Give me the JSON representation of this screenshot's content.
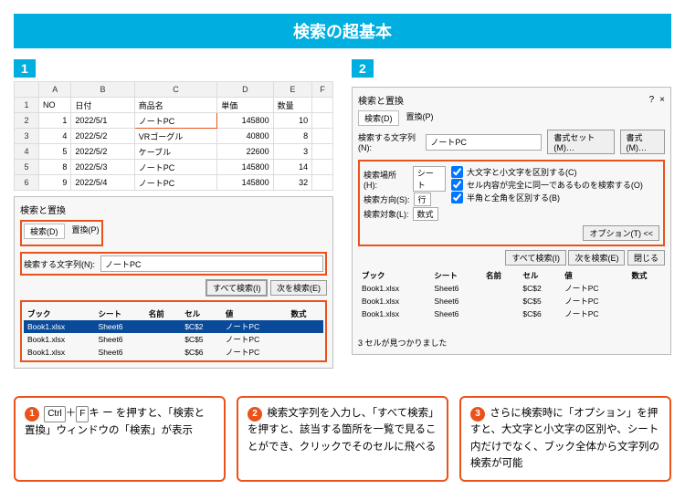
{
  "title": "検索の超基本",
  "panel1": {
    "num": "1",
    "cols": [
      "",
      "A",
      "B",
      "C",
      "D",
      "E",
      "F"
    ],
    "header_row": [
      "1",
      "NO",
      "日付",
      "商品名",
      "単価",
      "数量",
      ""
    ],
    "rows": [
      [
        "2",
        "1",
        "2022/5/1",
        "ノートPC",
        "145800",
        "10",
        ""
      ],
      [
        "3",
        "4",
        "2022/5/2",
        "VRゴーグル",
        "40800",
        "8",
        ""
      ],
      [
        "4",
        "5",
        "2022/5/2",
        "ケーブル",
        "22600",
        "3",
        ""
      ],
      [
        "5",
        "8",
        "2022/5/3",
        "ノートPC",
        "145800",
        "14",
        ""
      ],
      [
        "6",
        "9",
        "2022/5/4",
        "ノートPC",
        "145800",
        "32",
        ""
      ]
    ],
    "dialog": {
      "title": "検索と置換",
      "tab_search": "検索(D)",
      "tab_replace": "置換(P)",
      "find_label": "検索する文字列(N):",
      "find_value": "ノートPC",
      "btn_find_all": "すべて検索(I)",
      "btn_find_next": "次を検索(E)",
      "result_head": [
        "ブック",
        "シート",
        "名前",
        "セル",
        "値",
        "数式"
      ],
      "results": [
        [
          "Book1.xlsx",
          "Sheet6",
          "",
          "$C$2",
          "ノートPC",
          ""
        ],
        [
          "Book1.xlsx",
          "Sheet6",
          "",
          "$C$5",
          "ノートPC",
          ""
        ],
        [
          "Book1.xlsx",
          "Sheet6",
          "",
          "$C$6",
          "ノートPC",
          ""
        ]
      ]
    }
  },
  "panel2": {
    "num": "2",
    "dialog": {
      "title": "検索と置換",
      "tab_search": "検索(D)",
      "tab_replace": "置換(P)",
      "find_label": "検索する文字列(N):",
      "find_value": "ノートPC",
      "btn_format": "書式セット(M)…",
      "btn_format2": "書式(M)…",
      "scope_label": "検索場所(H):",
      "scope_value": "シート",
      "dir_label": "検索方向(S):",
      "dir_value": "行",
      "target_label": "検索対象(L):",
      "target_value": "数式",
      "chk1": "大文字と小文字を区別する(C)",
      "chk2": "セル内容が完全に同一であるものを検索する(O)",
      "chk3": "半角と全角を区別する(B)",
      "btn_options": "オプション(T) <<",
      "btn_find_all": "すべて検索(I)",
      "btn_find_next": "次を検索(E)",
      "btn_close": "閉じる",
      "result_head": [
        "ブック",
        "シート",
        "名前",
        "セル",
        "値",
        "数式"
      ],
      "results": [
        [
          "Book1.xlsx",
          "Sheet6",
          "",
          "$C$2",
          "ノートPC",
          ""
        ],
        [
          "Book1.xlsx",
          "Sheet6",
          "",
          "$C$5",
          "ノートPC",
          ""
        ],
        [
          "Book1.xlsx",
          "Sheet6",
          "",
          "$C$6",
          "ノートPC",
          ""
        ]
      ],
      "footer": "3 セルが見つかりました"
    }
  },
  "callouts": {
    "c1_num": "1",
    "c1_key1": "Ctrl",
    "c1_key2": "F",
    "c1_text_a": "＋",
    "c1_text_b": "キ ー を押すと、「検索と置換」ウィンドウの「検索」が表示",
    "c2_num": "2",
    "c2_text": "検索文字列を入力し、「すべて検索」を押すと、該当する箇所を一覧で見ることができ、クリックでそのセルに飛べる",
    "c3_num": "3",
    "c3_text": "さらに検索時に「オプション」を押すと、大文字と小文字の区別や、シート内だけでなく、ブック全体から文字列の検索が可能"
  }
}
